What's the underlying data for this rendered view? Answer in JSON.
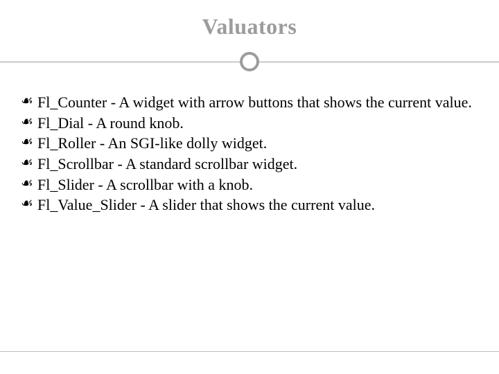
{
  "title": "Valuators",
  "list": {
    "items": [
      {
        "text": "Fl_Counter - A widget with arrow buttons that shows the current value."
      },
      {
        "text": "Fl_Dial - A round knob."
      },
      {
        "text": "Fl_Roller - An SGI-like dolly widget."
      },
      {
        "text": "Fl_Scrollbar - A standard scrollbar widget."
      },
      {
        "text": "Fl_Slider - A scrollbar with a knob."
      },
      {
        "text": "Fl_Value_Slider - A slider that shows the current value."
      }
    ]
  }
}
